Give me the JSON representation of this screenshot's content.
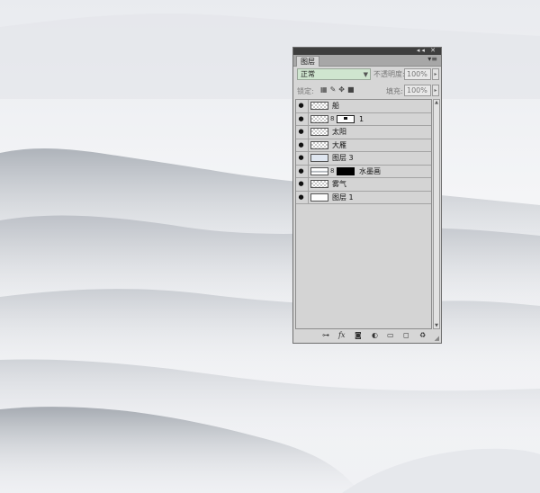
{
  "panel": {
    "tab_label": "图层",
    "titlebar_icons": "◂◂ ✕",
    "menu_icon": "▾≡",
    "blend_mode": "正常",
    "opacity_label": "不透明度:",
    "opacity_value": "100%",
    "lock_label": "锁定:",
    "fill_label": "填充:",
    "fill_value": "100%"
  },
  "layers": [
    {
      "name": "船",
      "visible": true
    },
    {
      "name": "1",
      "visible": true
    },
    {
      "name": "太阳",
      "visible": true
    },
    {
      "name": "大雁",
      "visible": true
    },
    {
      "name": "图层 3",
      "visible": true
    },
    {
      "name": "水墨画",
      "visible": true
    },
    {
      "name": "雾气",
      "visible": true
    },
    {
      "name": "图层 1",
      "visible": true
    }
  ],
  "footer_icons": [
    "link-icon",
    "fx-icon",
    "mask-icon",
    "adjustment-icon",
    "group-icon",
    "new-layer-icon",
    "trash-icon"
  ],
  "colors": {
    "blend_bg": "#cfe5cf",
    "panel_bg": "#d6d6d6",
    "titlebar": "#3e3e3e"
  }
}
